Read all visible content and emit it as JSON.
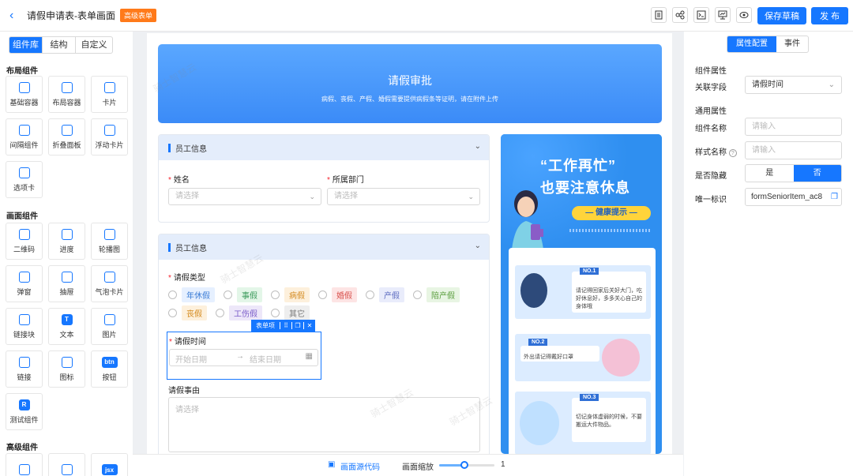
{
  "header": {
    "back_icon": "chevron-left-icon",
    "title": "请假申请表-表单画面",
    "badge": "高级表单",
    "toolbar_icons": [
      "list-icon",
      "share-icon",
      "code-icon",
      "preview-icon",
      "eye-icon"
    ],
    "save_draft": "保存草稿",
    "publish": "发 布"
  },
  "left_panel": {
    "tabs": [
      "组件库",
      "结构",
      "自定义"
    ],
    "sections": [
      {
        "title": "布局组件",
        "items": [
          {
            "label": "基础容器",
            "icon": "container-icon"
          },
          {
            "label": "布局容器",
            "icon": "layout-icon"
          },
          {
            "label": "卡片",
            "icon": "card-icon"
          },
          {
            "label": "间隔组件",
            "icon": "grid-icon"
          },
          {
            "label": "折叠面板",
            "icon": "collapse-icon"
          },
          {
            "label": "浮动卡片",
            "icon": "float-card-icon"
          },
          {
            "label": "选项卡",
            "icon": "tabs-icon"
          }
        ]
      },
      {
        "title": "画面组件",
        "items": [
          {
            "label": "二维码",
            "icon": "qrcode-icon"
          },
          {
            "label": "进度",
            "icon": "progress-icon"
          },
          {
            "label": "轮播图",
            "icon": "carousel-icon"
          },
          {
            "label": "弹窗",
            "icon": "modal-icon"
          },
          {
            "label": "抽屉",
            "icon": "drawer-icon"
          },
          {
            "label": "气泡卡片",
            "icon": "bubble-icon"
          },
          {
            "label": "链接块",
            "icon": "link-block-icon"
          },
          {
            "label": "文本",
            "icon": "text-icon",
            "glyph": "T"
          },
          {
            "label": "图片",
            "icon": "image-icon"
          },
          {
            "label": "链接",
            "icon": "link-icon"
          },
          {
            "label": "图标",
            "icon": "emoji-icon"
          },
          {
            "label": "按钮",
            "icon": "button-icon",
            "glyph": "btn"
          },
          {
            "label": "测试组件",
            "icon": "test-icon",
            "glyph": "R"
          }
        ]
      },
      {
        "title": "高级组件",
        "items": [
          {
            "label": "",
            "icon": "table-icon"
          },
          {
            "label": "",
            "icon": "doc-icon"
          },
          {
            "label": "",
            "icon": "jsx-icon",
            "glyph": "jsx"
          }
        ]
      }
    ]
  },
  "canvas": {
    "banner_title": "请假审批",
    "banner_subtitle": "病假、丧假、产假、婚假需要提供病假条等证明，请在附件上传",
    "card1": {
      "title": "员工信息",
      "name_label": "姓名",
      "name_placeholder": "请选择",
      "dept_label": "所属部门",
      "dept_placeholder": "请选择"
    },
    "card2": {
      "title": "员工信息",
      "type_label": "请假类型",
      "leave_types_row1": [
        {
          "label": "年休假",
          "bg": "#e6f0ff",
          "fg": "#3a7bd5"
        },
        {
          "label": "事假",
          "bg": "#e3f6e8",
          "fg": "#3a9a5b"
        },
        {
          "label": "病假",
          "bg": "#fdf0dc",
          "fg": "#d48a1f"
        },
        {
          "label": "婚假",
          "bg": "#fde4e4",
          "fg": "#d9534f"
        },
        {
          "label": "产假",
          "bg": "#e9ecfb",
          "fg": "#5c6bc0"
        },
        {
          "label": "陪产假",
          "bg": "#e8f5e3",
          "fg": "#5a9e3e"
        }
      ],
      "leave_types_row2": [
        {
          "label": "丧假",
          "bg": "#fdf0dc",
          "fg": "#d48a1f"
        },
        {
          "label": "工伤假",
          "bg": "#ede7f9",
          "fg": "#7b5cc9"
        },
        {
          "label": "其它",
          "bg": "#eeeeee",
          "fg": "#777777"
        }
      ],
      "selection_toolbar_label": "表单项",
      "time_label": "请假时间",
      "start_placeholder": "开始日期",
      "end_placeholder": "结束日期",
      "reason_label": "请假事由",
      "reason_placeholder": "请选择"
    },
    "poster": {
      "title_line1": "“工作再忙”",
      "title_line2": "也要注意休息",
      "ribbon": "— 健康提示 —",
      "tips": [
        {
          "no": "NO.1",
          "text": "请记得回家后关好大门，吃好休息好，多多关心自己的身体哦"
        },
        {
          "no": "NO.2",
          "text": "外出请记得戴好口罩"
        },
        {
          "no": "NO.3",
          "text": "切记身体虚弱的时候，不要搬运大件物品。"
        }
      ]
    },
    "watermark": "骑士智慧云"
  },
  "bottom_bar": {
    "source_label": "画面源代码",
    "zoom_label": "画面缩放",
    "zoom_value": "1",
    "zoom_fraction": 0.45
  },
  "right_panel": {
    "tabs": [
      "属性配置",
      "事件"
    ],
    "component_section": "组件属性",
    "field_label": "关联字段",
    "field_value": "请假时间",
    "common_section": "通用属性",
    "name_label": "组件名称",
    "name_placeholder": "请输入",
    "style_label": "样式名称",
    "style_placeholder": "请输入",
    "hidden_label": "是否隐藏",
    "hidden_yes": "是",
    "hidden_no": "否",
    "id_label": "唯一标识",
    "id_value": "formSeniorItem_ac8"
  }
}
